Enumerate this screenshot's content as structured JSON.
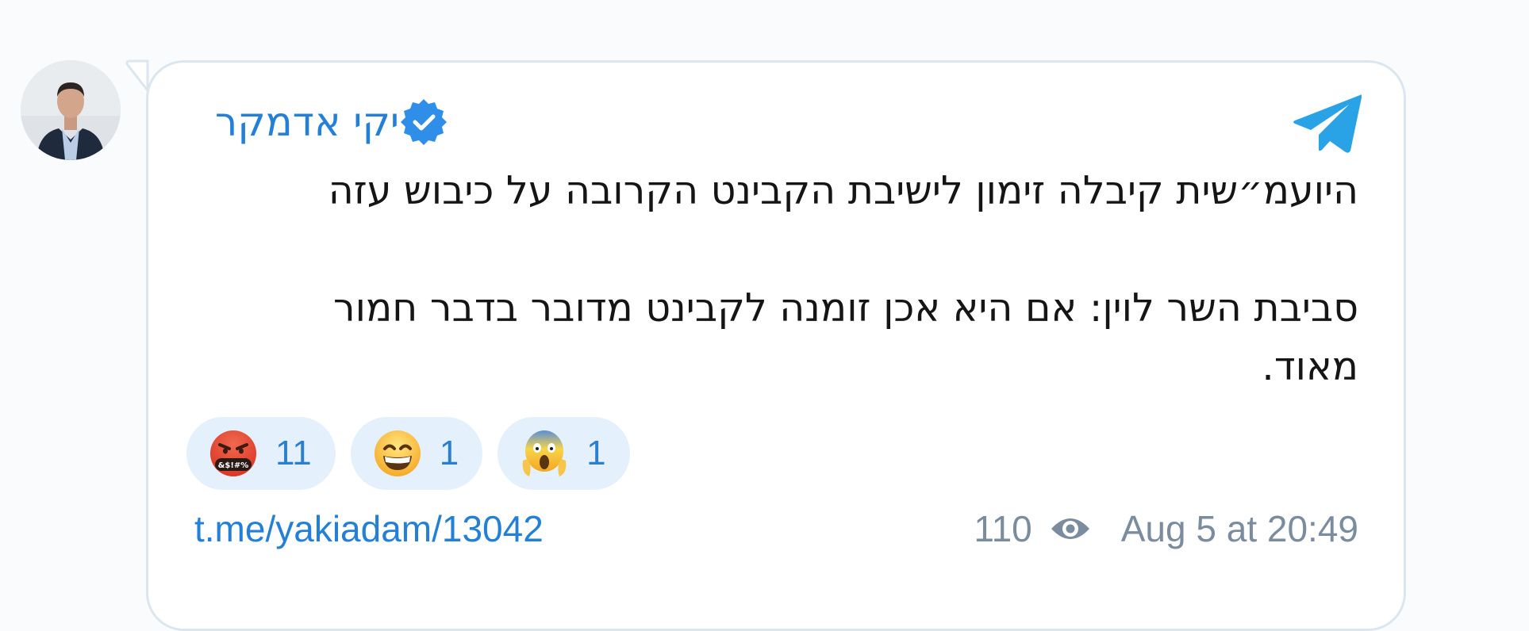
{
  "post": {
    "author_name": "יקי אדמקר",
    "verified": true,
    "message_lines": [
      "היועמ״שית קיבלה זימון לישיבת הקבינט הקרובה על כיבוש עזה",
      "",
      "סביבת השר לוין: אם היא אכן זומנה לקבינט מדובר בדבר חמור",
      "מאוד."
    ],
    "reactions": [
      {
        "emoji": "face-with-symbols-on-mouth",
        "count": "11"
      },
      {
        "emoji": "grinning-face-with-smiling-eyes",
        "count": "1"
      },
      {
        "emoji": "face-screaming-in-fear",
        "count": "1"
      }
    ],
    "link": "t.me/yakiadam/13042",
    "views": "110",
    "date": "Aug 5 at 20:49"
  },
  "icons": {
    "app": "telegram-icon",
    "verified": "verified-badge-icon",
    "views": "eye-icon"
  },
  "colors": {
    "accent": "#2480d6",
    "reaction_bg": "#e4f0fb",
    "meta_text": "#7a8c9e",
    "telegram_blue": "#2aa3e6"
  }
}
